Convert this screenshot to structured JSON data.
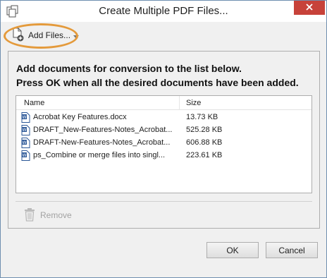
{
  "window": {
    "title": "Create Multiple PDF Files...",
    "close_icon": "close-icon"
  },
  "toolbar": {
    "add_files_label": "Add Files...",
    "add_files_icon": "add-document-icon"
  },
  "instructions": {
    "line1": "Add documents for conversion to the list below.",
    "line2": "Press OK when all the desired documents have been added."
  },
  "file_list": {
    "columns": {
      "name": "Name",
      "size": "Size"
    },
    "rows": [
      {
        "name": "Acrobat Key Features.docx",
        "size": "13.73 KB"
      },
      {
        "name": "DRAFT_New-Features-Notes_Acrobat...",
        "size": "525.28 KB"
      },
      {
        "name": "DRAFT-New-Features-Notes_Acrobat...",
        "size": "606.88 KB"
      },
      {
        "name": "ps_Combine or merge files into singl...",
        "size": "223.61 KB"
      }
    ]
  },
  "remove": {
    "label": "Remove",
    "icon": "trash-icon"
  },
  "buttons": {
    "ok": "OK",
    "cancel": "Cancel"
  },
  "colors": {
    "close": "#c7423a",
    "highlight": "#e49a3b",
    "word_icon": "#2b5797"
  }
}
